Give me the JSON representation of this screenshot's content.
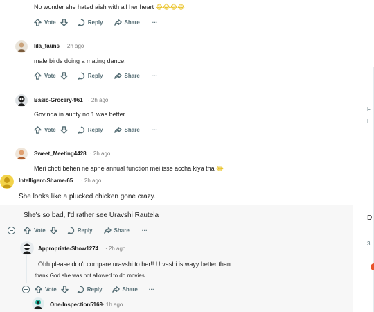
{
  "action_labels": {
    "vote": "Vote",
    "reply": "Reply",
    "share": "Share",
    "more": "···"
  },
  "comments": [
    {
      "user": "",
      "time": "",
      "text": "No wonder she hated aish with all her heart",
      "emoji": "😂😂😂😂"
    },
    {
      "user": "lila_fauns",
      "time": "· 2h ago",
      "text": "male birds doing a mating dance:"
    },
    {
      "user": "Basic-Grocery-961",
      "time": "· 2h ago",
      "text": "Govinda in aunty no 1 was better"
    },
    {
      "user": "Sweet_Meeting4428",
      "time": "· 2h ago",
      "text": "Meri choti behen ne apne annual function mei isse accha kiya tha",
      "emoji": "😂"
    },
    {
      "user": "Intelligent-Shame-65",
      "time": "· 2h ago",
      "text": "She looks like a plucked chicken gone crazy."
    },
    {
      "user": "",
      "time": "",
      "text": "She's so bad, I'd rather see Uravshi Rautela"
    },
    {
      "user": "Appropriate-Show1274",
      "time": "· 2h ago",
      "text": "Ohh please don't compare uravshi to her!! Urvashi is wayy better than"
    },
    {
      "user": "",
      "time": "",
      "text": "thank God she was not allowed to do movies"
    },
    {
      "user": "One-Inspection5169",
      "time": "· 1h ago",
      "text": ""
    }
  ],
  "sidebar_fragments": [
    "F",
    "F",
    "D",
    "3"
  ]
}
